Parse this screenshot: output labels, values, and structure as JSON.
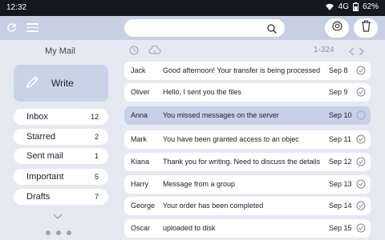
{
  "status_bar": {
    "time": "12:32",
    "network": "4G",
    "battery": "62%"
  },
  "toolbar": {
    "search_placeholder": ""
  },
  "sidebar": {
    "title": "My Mail",
    "write_label": "Write",
    "folders": [
      {
        "name": "Inbox",
        "count": "12"
      },
      {
        "name": "Starred",
        "count": "2"
      },
      {
        "name": "Sent mail",
        "count": "1"
      },
      {
        "name": "Important",
        "count": "5"
      },
      {
        "name": "Drafts",
        "count": "7"
      }
    ]
  },
  "list": {
    "range": "1-324",
    "messages": [
      {
        "sender": "Jack",
        "subject": "Good afternoon! Your transfer is being processed",
        "date": "Sep 8",
        "selected": false
      },
      {
        "sender": "Oliver",
        "subject": "Hello, I sent you the files",
        "date": "Sep 9",
        "selected": false
      },
      {
        "sender": "Anna",
        "subject": "You missed messages on the server",
        "date": "Sep 10",
        "selected": true
      },
      {
        "sender": "Mark",
        "subject": "You have been granted access to an objec",
        "date": "Sep 11",
        "selected": false
      },
      {
        "sender": "Kiana",
        "subject": "Thank you for writing. Need to discuss the details",
        "date": "Sep 12",
        "selected": false
      },
      {
        "sender": "Harry",
        "subject": "Message from a group",
        "date": "Sep 13",
        "selected": false
      },
      {
        "sender": "George",
        "subject": "Your order has been completed",
        "date": "Sep 14",
        "selected": false
      },
      {
        "sender": "Oscar",
        "subject": "uploaded to disk",
        "date": "Sep 15",
        "selected": false
      }
    ]
  },
  "colors": {
    "accent": "#c7d0e9",
    "toolbar": "#c7cfe2",
    "background": "#e6e9f1",
    "status_bar": "#151821"
  },
  "icons": [
    "refresh-icon",
    "menu-icon",
    "search-icon",
    "gear-icon",
    "trash-icon",
    "pencil-icon",
    "clock-icon",
    "cloud-icon",
    "chevron-left-icon",
    "chevron-right-icon",
    "chevron-down-icon",
    "check-circle-icon",
    "wifi-icon",
    "battery-icon"
  ]
}
